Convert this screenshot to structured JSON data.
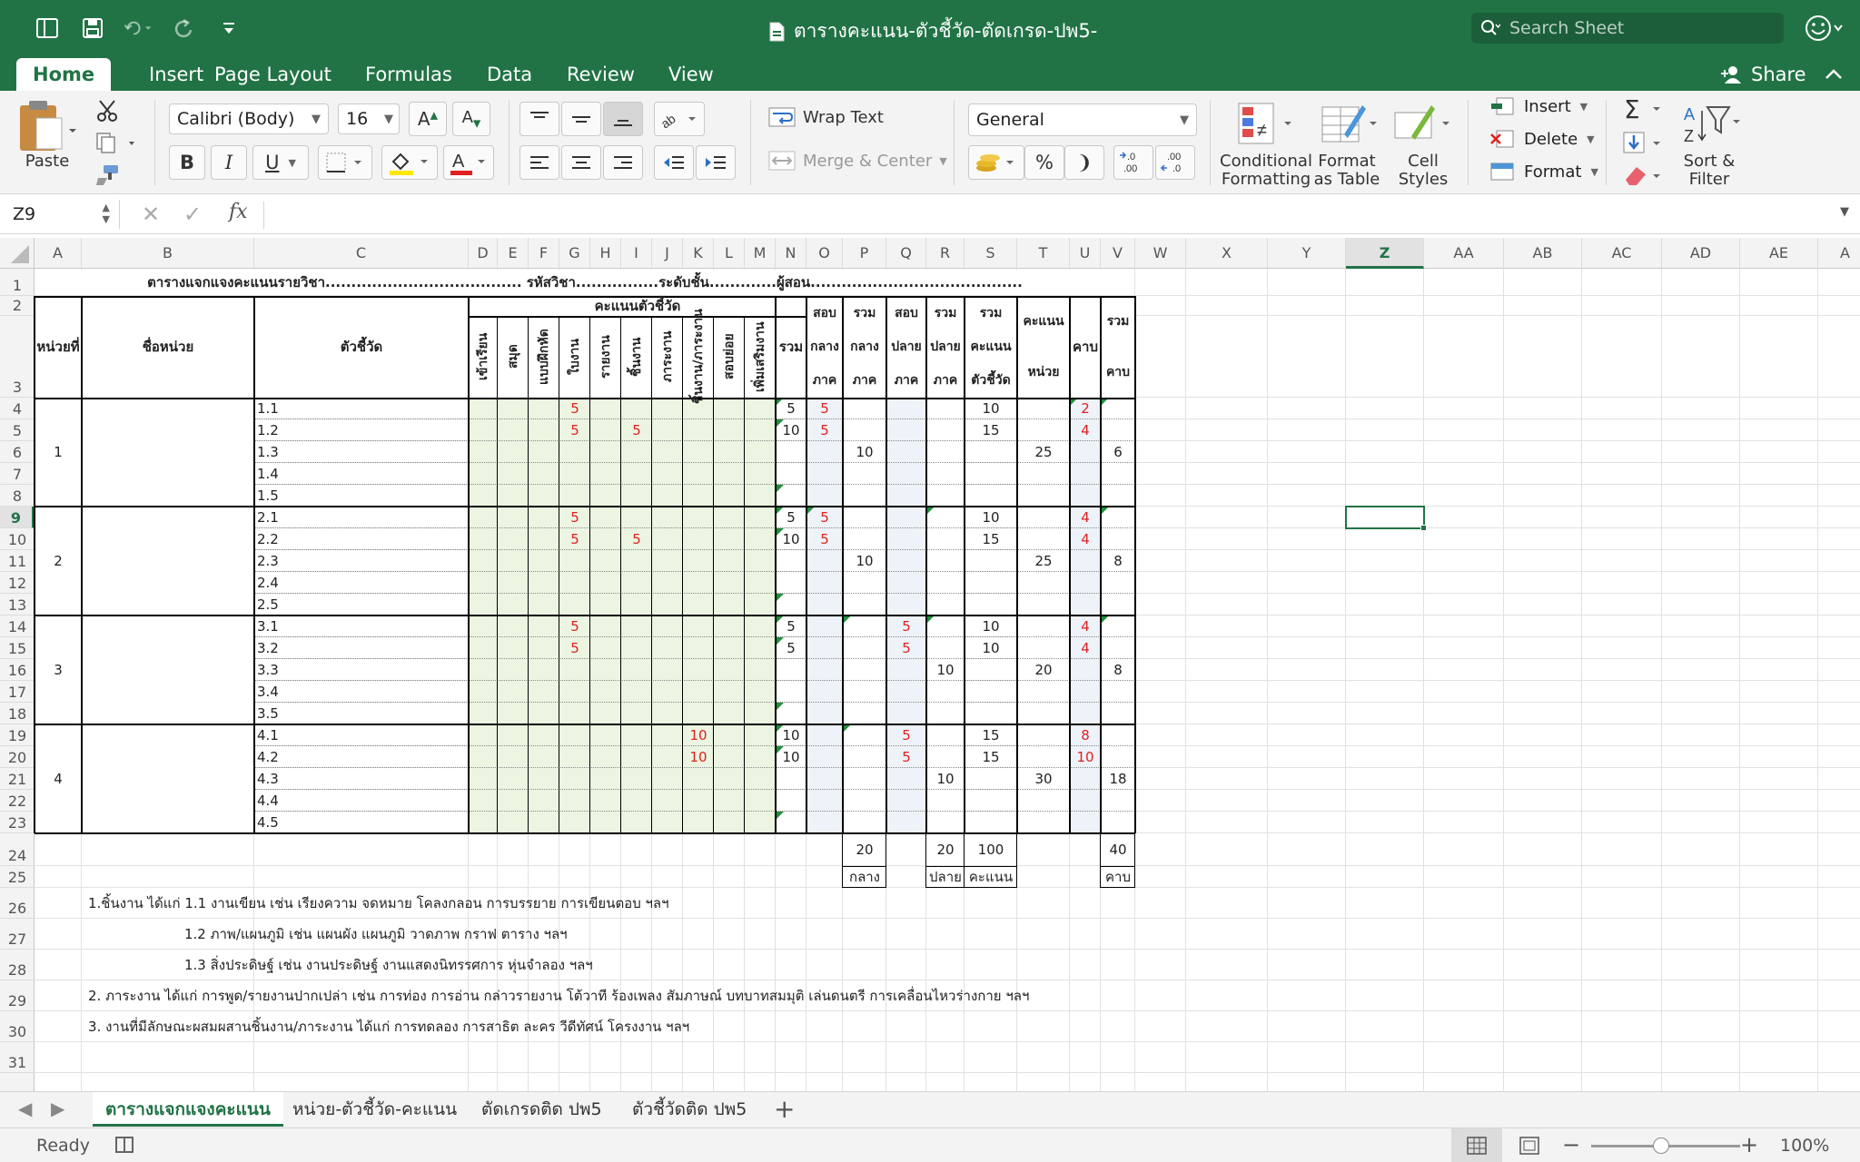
{
  "window": {
    "title": "ตารางคะแนน-ตัวชี้วัด-ตัดเกรด-ปพ5-",
    "search_placeholder": "Search Sheet"
  },
  "ribbon_tabs": [
    "Home",
    "Insert",
    "Page Layout",
    "Formulas",
    "Data",
    "Review",
    "View"
  ],
  "active_tab": "Home",
  "share_label": "Share",
  "ribbon": {
    "paste": "Paste",
    "font_name": "Calibri (Body)",
    "font_size": "16",
    "wrap_text": "Wrap Text",
    "merge_center": "Merge & Center",
    "number_format": "General",
    "conditional_formatting": "Conditional Formatting",
    "format_as_table": "Format as Table",
    "cell_styles": "Cell Styles",
    "insert": "Insert",
    "delete": "Delete",
    "format": "Format",
    "sort_filter": "Sort & Filter",
    "bold": "B",
    "italic": "I",
    "underline": "U"
  },
  "formula_bar": {
    "name_box": "Z9",
    "fx": "fx",
    "content": ""
  },
  "columns": [
    "A",
    "B",
    "C",
    "D",
    "E",
    "F",
    "G",
    "H",
    "I",
    "J",
    "K",
    "L",
    "M",
    "N",
    "O",
    "P",
    "Q",
    "R",
    "S",
    "T",
    "U",
    "V",
    "W",
    "X",
    "Y",
    "Z",
    "AA",
    "AB",
    "AC",
    "AD",
    "AE",
    "A"
  ],
  "selected_column": "Z",
  "rows": [
    "1",
    "2",
    "3",
    "4",
    "5",
    "6",
    "7",
    "8",
    "9",
    "10",
    "11",
    "12",
    "13",
    "14",
    "15",
    "16",
    "17",
    "18",
    "19",
    "20",
    "21",
    "22",
    "23",
    "24",
    "25",
    "26",
    "27",
    "28",
    "29",
    "30",
    "31"
  ],
  "selected_row": "9",
  "sheet": {
    "title_row": "ตารางแจกแจงคะแนนรายวิชา...................................... รหัสวิชา................ระดับชั้น.............ผู้สอน.........................................",
    "hdr_unit_no": "หน่วยที่",
    "hdr_unit_name": "ชื่อหน่วย",
    "hdr_indicator": "ตัวชี้วัด",
    "hdr_score_indicator": "คะแนนตัวชี้วัด",
    "hdr_vertical": [
      "เข้าเรียน",
      "สมุด",
      "แบบฝึกหัด",
      "ใบงาน",
      "รายงาน",
      "ชิ้นงาน",
      "ภาระงาน",
      "ชิ้นงาน/ภาระงาน",
      "สอบย่อย",
      "เพิ่มเสริมงาน"
    ],
    "hdr_total": "รวม",
    "hdr_midterm": [
      "สอบ",
      "กลาง",
      "ภาค"
    ],
    "hdr_total_mid": [
      "รวม",
      "กลาง",
      "ภาค"
    ],
    "hdr_final": [
      "สอบ",
      "ปลาย",
      "ภาค"
    ],
    "hdr_total_final": [
      "รวม",
      "ปลาย",
      "ภาค"
    ],
    "hdr_total_score": [
      "รวม",
      "คะแนน",
      "ตัวชี้วัด"
    ],
    "hdr_unit_score": [
      "คะแนน",
      "หน่วย"
    ],
    "hdr_period": "คาบ",
    "hdr_total_period": [
      "รวม",
      "คาบ"
    ],
    "units": [
      {
        "no": "1",
        "indicators": [
          "1.1",
          "1.2",
          "1.3",
          "1.4",
          "1.5"
        ],
        "G": [
          "5",
          "5",
          "",
          "",
          ""
        ],
        "I": [
          "",
          "5",
          "",
          "",
          ""
        ],
        "K": [
          "",
          "",
          "",
          "",
          ""
        ],
        "N": [
          "5",
          "10",
          "",
          "",
          ""
        ],
        "O": [
          "5",
          "5",
          "",
          "",
          ""
        ],
        "Q": [
          "",
          "",
          "",
          "",
          ""
        ],
        "S": [
          "10",
          "15",
          "",
          "",
          ""
        ],
        "U": [
          "2",
          "4",
          "",
          "",
          ""
        ],
        "P": "10",
        "R": "",
        "T": "25",
        "V": "6"
      },
      {
        "no": "2",
        "indicators": [
          "2.1",
          "2.2",
          "2.3",
          "2.4",
          "2.5"
        ],
        "G": [
          "5",
          "5",
          "",
          "",
          ""
        ],
        "I": [
          "",
          "5",
          "",
          "",
          ""
        ],
        "K": [
          "",
          "",
          "",
          "",
          ""
        ],
        "N": [
          "5",
          "10",
          "",
          "",
          ""
        ],
        "O": [
          "5",
          "5",
          "",
          "",
          ""
        ],
        "Q": [
          "",
          "",
          "",
          "",
          ""
        ],
        "S": [
          "10",
          "15",
          "",
          "",
          ""
        ],
        "U": [
          "4",
          "4",
          "",
          "",
          ""
        ],
        "P": "10",
        "R": "",
        "T": "25",
        "V": "8"
      },
      {
        "no": "3",
        "indicators": [
          "3.1",
          "3.2",
          "3.3",
          "3.4",
          "3.5"
        ],
        "G": [
          "5",
          "5",
          "",
          "",
          ""
        ],
        "I": [
          "",
          "",
          "",
          "",
          ""
        ],
        "K": [
          "",
          "",
          "",
          "",
          ""
        ],
        "N": [
          "5",
          "5",
          "",
          "",
          ""
        ],
        "O": [
          "",
          "",
          "",
          "",
          ""
        ],
        "Q": [
          "5",
          "5",
          "",
          "",
          ""
        ],
        "S": [
          "10",
          "10",
          "",
          "",
          ""
        ],
        "U": [
          "4",
          "4",
          "",
          "",
          ""
        ],
        "P": "",
        "R": "10",
        "T": "20",
        "V": "8"
      },
      {
        "no": "4",
        "indicators": [
          "4.1",
          "4.2",
          "4.3",
          "4.4",
          "4.5"
        ],
        "G": [
          "",
          "",
          "",
          "",
          ""
        ],
        "I": [
          "",
          "",
          "",
          "",
          ""
        ],
        "K": [
          "10",
          "10",
          "",
          "",
          ""
        ],
        "N": [
          "10",
          "10",
          "",
          "",
          ""
        ],
        "O": [
          "",
          "",
          "",
          "",
          ""
        ],
        "Q": [
          "5",
          "5",
          "",
          "",
          ""
        ],
        "S": [
          "15",
          "15",
          "",
          "",
          ""
        ],
        "U": [
          "8",
          "10",
          "",
          "",
          ""
        ],
        "P": "",
        "R": "10",
        "T": "30",
        "V": "18"
      }
    ],
    "totals": {
      "P": "20",
      "R": "20",
      "S": "100",
      "V": "40"
    },
    "total_labels": {
      "P": "กลาง",
      "R": "ปลาย",
      "S": "คะแนน",
      "V": "คาบ"
    },
    "notes": [
      "1.ชิ้นงาน ได้แก่ 1.1 งานเขียน เช่น เรียงความ  จดหมาย  โคลงกลอน  การบรรยาย  การเขียนตอบ ฯลฯ",
      "1.2  ภาพ/แผนภูมิ เช่น แผนผัง แผนภูมิ วาดภาพ กราฟ ตาราง ฯลฯ",
      "1.3 สิ่งประดิษฐ์ เช่น งานประดิษฐ์ งานแสดงนิทรรศการ หุ่นจำลอง ฯลฯ",
      "2.  ภาระงาน  ได้แก่ การพูด/รายงานปากเปล่า เช่น การท่อง การอ่าน กล่าวรายงาน โต้วาที ร้องเพลง สัมภาษณ์ บทบาทสมมุติ เล่นดนตรี การเคลื่อนไหวร่างกาย ฯลฯ",
      "3.  งานที่มีลักษณะผสมผสานชิ้นงาน/ภาระงาน ได้แก่ การทดลอง  การสาธิต  ละคร  วีดีทัศน์  โครงงาน ฯลฯ"
    ]
  },
  "sheet_tabs": [
    "ตารางแจกแจงคะแนน",
    "หน่วย-ตัวชี้วัด-คะแนน",
    "ตัดเกรดติด ปพ5",
    "ตัวชี้วัดติด ปพ5"
  ],
  "active_sheet": "ตารางแจกแจงคะแนน",
  "status": {
    "ready": "Ready",
    "zoom": "100%"
  },
  "colors": {
    "brand": "#217346",
    "red_values": "#e02020",
    "green_fill": "#ebf5e1",
    "blue_fill": "#edf3f8"
  }
}
